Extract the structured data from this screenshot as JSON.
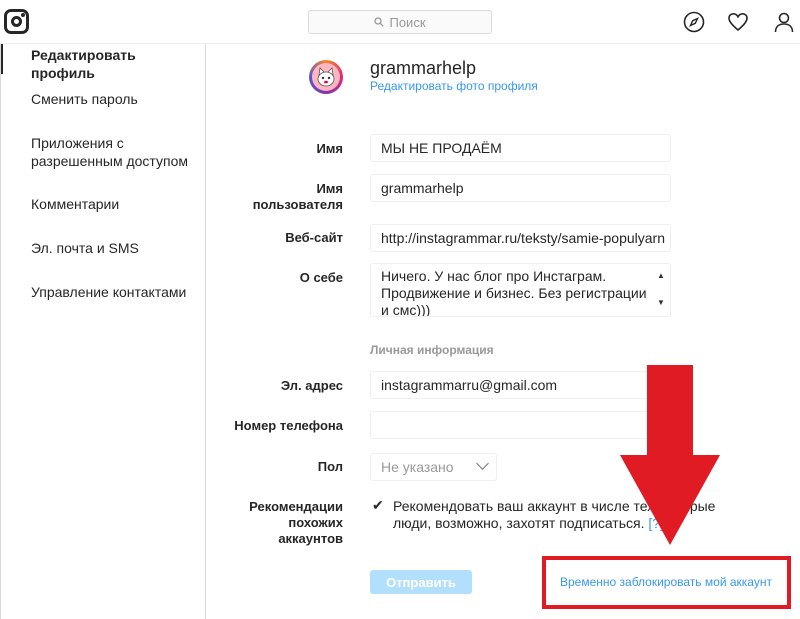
{
  "header": {
    "search_placeholder": "Поиск"
  },
  "sidebar": {
    "items": [
      {
        "label": "Редактировать профиль"
      },
      {
        "label": "Сменить пароль"
      },
      {
        "label": "Приложения с разрешенным доступом"
      },
      {
        "label": "Комментарии"
      },
      {
        "label": "Эл. почта и SMS"
      },
      {
        "label": "Управление контактами"
      }
    ]
  },
  "profile": {
    "username": "grammarhelp",
    "change_photo_label": "Редактировать фото профиля"
  },
  "form": {
    "name_label": "Имя",
    "name_value": "МЫ НЕ ПРОДАЁМ",
    "username_label": "Имя пользователя",
    "username_value": "grammarhelp",
    "website_label": "Веб-сайт",
    "website_value": "http://instagrammar.ru/teksty/samie-populyarn",
    "bio_label": "О себе",
    "bio_value": "Ничего. У нас блог про Инстаграм. Продвижение и бизнес. Без регистрации и смс)))",
    "private_section_title": "Личная информация",
    "email_label": "Эл. адрес",
    "email_value": "instagrammarru@gmail.com",
    "phone_label": "Номер телефона",
    "phone_value": "",
    "gender_label": "Пол",
    "gender_value": "Не указано",
    "recommendations_label": "Рекомендации похожих аккаунтов",
    "recommendations_checked": true,
    "recommendations_text": "Рекомендовать ваш аккаунт в числе тех, которые люди, возможно, захотят подписаться.",
    "recommendations_help": "[?]",
    "submit_label": "Отправить",
    "block_account_label": "Временно заблокировать мой аккаунт"
  },
  "colors": {
    "accent": "#3897f0",
    "submit_disabled": "#b2dffc",
    "highlight": "#e01b24"
  }
}
